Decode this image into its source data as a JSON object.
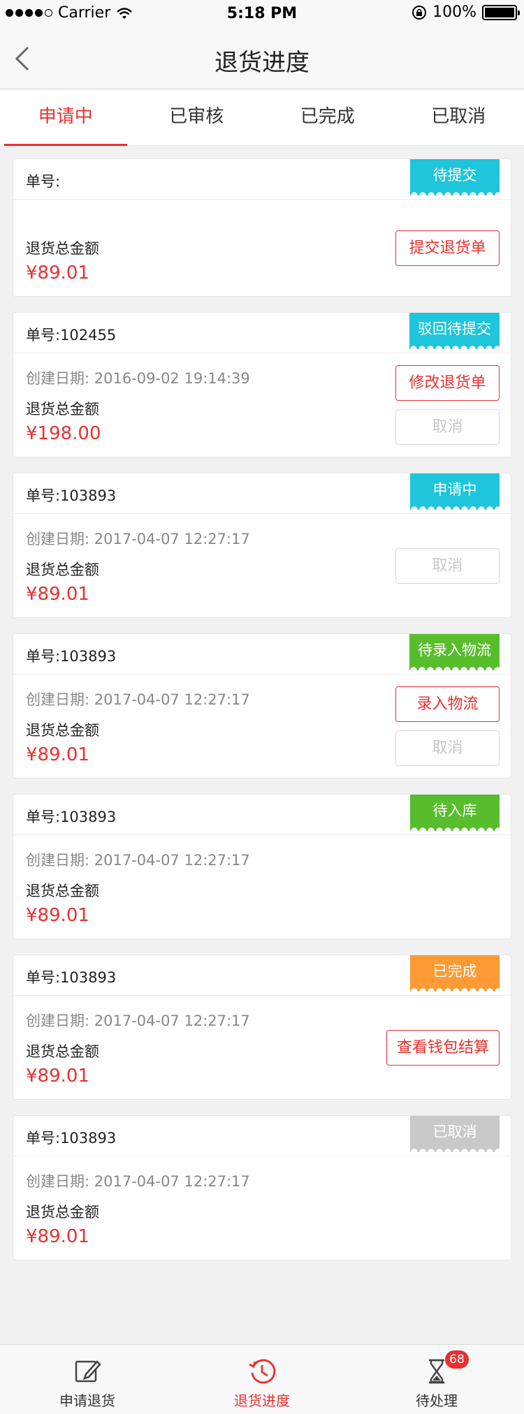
{
  "status_bar": {
    "carrier": "Carrier",
    "time": "5:18 PM",
    "battery": "100%"
  },
  "nav": {
    "title": "退货进度"
  },
  "tabs": [
    {
      "label": "申请中"
    },
    {
      "label": "已审核"
    },
    {
      "label": "已完成"
    },
    {
      "label": "已取消"
    }
  ],
  "colors": {
    "accent": "#e8312f",
    "cyan": "#1ec5db",
    "green": "#58bd2d",
    "orange": "#ff9a35",
    "gray": "#c9c9c9"
  },
  "orders": [
    {
      "order_no": "单号:",
      "status": "待提交",
      "status_color": "#1ec5db",
      "created": "",
      "amount_label": "退货总金额",
      "amount": "¥89.01",
      "actions": [
        {
          "label": "提交退货单",
          "enabled": true
        }
      ]
    },
    {
      "order_no": "单号:102455",
      "status": "驳回待提交",
      "status_color": "#1ec5db",
      "created": "创建日期: 2016-09-02 19:14:39",
      "amount_label": "退货总金额",
      "amount": "¥198.00",
      "actions": [
        {
          "label": "修改退货单",
          "enabled": true
        },
        {
          "label": "取消",
          "enabled": false
        }
      ]
    },
    {
      "order_no": "单号:103893",
      "status": "申请中",
      "status_color": "#1ec5db",
      "created": "创建日期: 2017-04-07 12:27:17",
      "amount_label": "退货总金额",
      "amount": "¥89.01",
      "actions": [
        {
          "label": "取消",
          "enabled": false
        }
      ]
    },
    {
      "order_no": "单号:103893",
      "status": "待录入物流",
      "status_color": "#58bd2d",
      "created": "创建日期: 2017-04-07 12:27:17",
      "amount_label": "退货总金额",
      "amount": "¥89.01",
      "actions": [
        {
          "label": "录入物流",
          "enabled": true
        },
        {
          "label": "取消",
          "enabled": false
        }
      ]
    },
    {
      "order_no": "单号:103893",
      "status": "待入库",
      "status_color": "#58bd2d",
      "created": "创建日期: 2017-04-07 12:27:17",
      "amount_label": "退货总金额",
      "amount": "¥89.01",
      "actions": []
    },
    {
      "order_no": "单号:103893",
      "status": "已完成",
      "status_color": "#ff9a35",
      "created": "创建日期: 2017-04-07 12:27:17",
      "amount_label": "退货总金额",
      "amount": "¥89.01",
      "actions": [
        {
          "label": "查看钱包结算",
          "enabled": true
        }
      ]
    },
    {
      "order_no": "单号:103893",
      "status": "已取消",
      "status_color": "#c9c9c9",
      "created": "创建日期: 2017-04-07 12:27:17",
      "amount_label": "退货总金额",
      "amount": "¥89.01",
      "actions": []
    }
  ],
  "tabbar": {
    "items": [
      {
        "label": "申请退货",
        "icon": "edit-icon"
      },
      {
        "label": "退货进度",
        "icon": "clock-icon",
        "active": true
      },
      {
        "label": "待处理",
        "icon": "hourglass-icon",
        "badge": "68"
      }
    ]
  }
}
